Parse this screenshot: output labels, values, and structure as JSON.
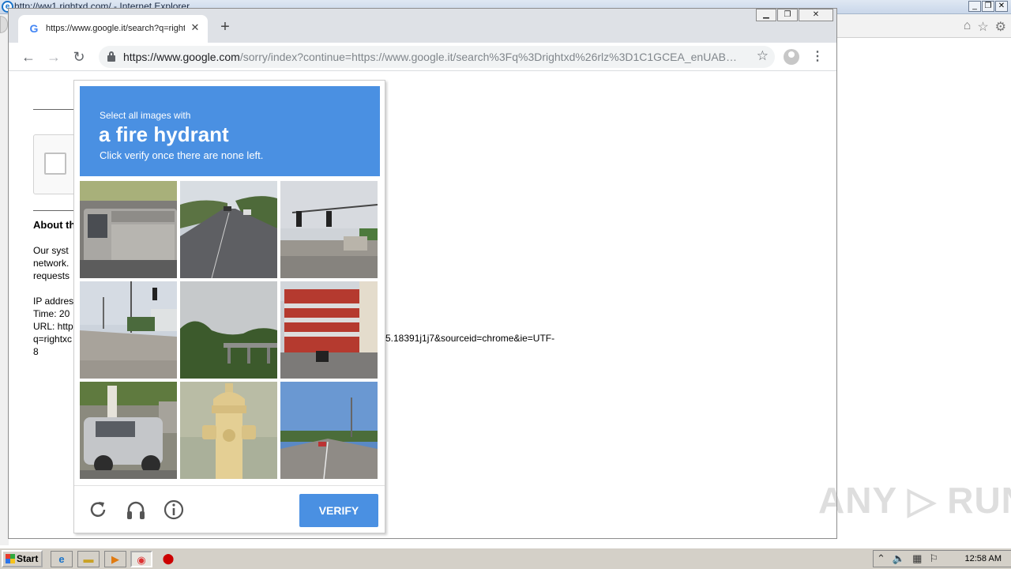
{
  "ie": {
    "title": "http://ww1.rightxd.com/ - Internet Explorer",
    "logo_letter": "e",
    "toolbar_icons": [
      "home-icon",
      "star-icon",
      "gear-icon"
    ]
  },
  "chrome": {
    "tab": {
      "title": "https://www.google.it/search?q=rightxd",
      "favicon": "G",
      "close": "✕"
    },
    "new_tab": "+",
    "window_buttons": {
      "minimize": "▁",
      "restore": "❐",
      "close": "✕"
    },
    "nav": {
      "back": "←",
      "forward": "→",
      "reload": "↻"
    },
    "url_host": "https://www.google.com",
    "url_path": "/sorry/index?continue=https://www.google.it/search%3Fq%3Drightxd%26rlz%3D1C1GCEA_enUAB…",
    "bookmark_star": "☆",
    "menu": "⋮"
  },
  "page": {
    "about_title": "About th",
    "paragraph": [
      "Our syst",
      "network.",
      "requests"
    ],
    "details": [
      "IP addres",
      "Time: 20",
      "URL: http",
      "q=rightxc",
      "8"
    ],
    "url_tail": "5.18391j1j7&sourceid=chrome&ie=UTF-"
  },
  "captcha": {
    "line1": "Select all images with",
    "target": "a fire hydrant",
    "line2": "Click verify once there are none left.",
    "verify_label": "VERIFY",
    "footer_icons": [
      "reload-icon",
      "headphones-icon",
      "info-icon"
    ],
    "tiles": [
      "pickup-truck-bed",
      "road-with-cars",
      "intersection-traffic-light",
      "road-traffic-lights",
      "bridge-trees",
      "red-brick-building",
      "parked-suv",
      "fire-hydrant",
      "highway-road"
    ]
  },
  "watermark": "ANY ▷ RUN",
  "taskbar": {
    "start_label": "Start",
    "apps": [
      "ie-icon",
      "folder-icon",
      "media-icon",
      "chrome-icon",
      "stop-icon"
    ],
    "tray_icons": [
      "arrow-up-icon",
      "volume-icon",
      "network-icon",
      "flag-icon"
    ],
    "clock": "12:58 AM"
  }
}
